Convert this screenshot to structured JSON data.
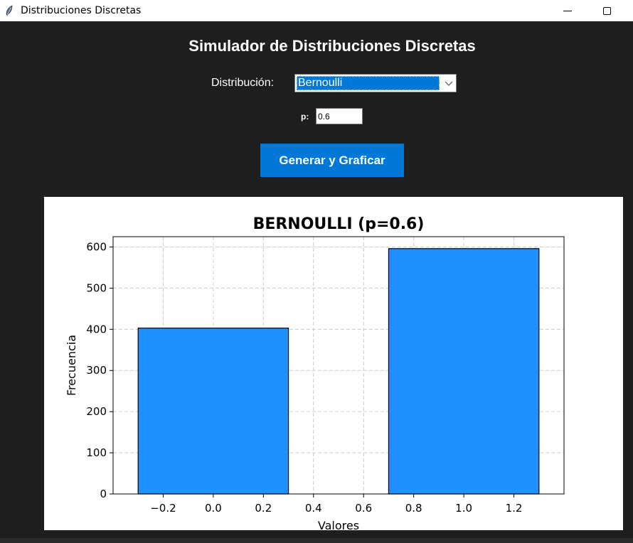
{
  "window": {
    "title": "Distribuciones Discretas"
  },
  "header": {
    "title": "Simulador de Distribuciones Discretas"
  },
  "controls": {
    "distribution_label": "Distribución:",
    "distribution_value": "Bernoulli",
    "p_label": "p:",
    "p_value": "0.6",
    "generate_button": "Generar y Graficar"
  },
  "chart_data": {
    "type": "bar",
    "title": "BERNOULLI (p=0.6)",
    "xlabel": "Valores",
    "ylabel": "Frecuencia",
    "x": [
      0,
      1
    ],
    "values": [
      403,
      596
    ],
    "bar_width": 0.6,
    "xlim": [
      -0.4,
      1.4
    ],
    "ylim": [
      0,
      625
    ],
    "xticks": [
      -0.2,
      0.0,
      0.2,
      0.4,
      0.6,
      0.8,
      1.0,
      1.2
    ],
    "xtick_labels": [
      "−0.2",
      "0.0",
      "0.2",
      "0.4",
      "0.6",
      "0.8",
      "1.0",
      "1.2"
    ],
    "yticks": [
      0,
      100,
      200,
      300,
      400,
      500,
      600
    ],
    "ytick_labels": [
      "0",
      "100",
      "200",
      "300",
      "400",
      "500",
      "600"
    ],
    "grid": true,
    "bar_color": "#1e90ff",
    "edge_color": "#000000"
  }
}
